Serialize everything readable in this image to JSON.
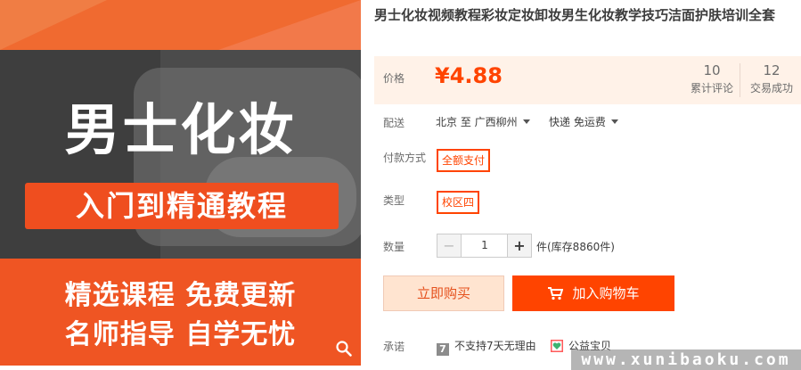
{
  "product_image": {
    "headline": "男士化妆",
    "subtitle": "入门到精通教程",
    "line1": "精选课程 免费更新",
    "line2": "名师指导 自学无忧"
  },
  "title": "男士化妆视频教程彩妆定妆卸妆男生化妆教学技巧洁面护肤培训全套",
  "price": {
    "label": "价格",
    "value": "¥4.88",
    "accent_color": "#ff4400"
  },
  "stats": {
    "reviews_count": "10",
    "reviews_label": "累计评论",
    "trades_count": "12",
    "trades_label": "交易成功"
  },
  "shipping": {
    "label": "配送",
    "route": "北京 至  广西柳州",
    "method": "快递 免运费"
  },
  "payment": {
    "label": "付款方式",
    "option": "全额支付"
  },
  "type": {
    "label": "类型",
    "option": "校区四"
  },
  "quantity": {
    "label": "数量",
    "minus": "−",
    "value": "1",
    "plus": "+",
    "stock": "件(库存8860件)"
  },
  "actions": {
    "buy_now": "立即购买",
    "add_to_cart": "加入购物车"
  },
  "promise": {
    "label": "承诺",
    "no_return_icon_text": "7",
    "no_return": "不支持7天无理由",
    "charity": "公益宝贝"
  },
  "watermark": "www.xunibaoku.com",
  "icons": {
    "zoom": "magnifier-icon",
    "cart": "cart-icon",
    "charity": "heart-icon"
  }
}
